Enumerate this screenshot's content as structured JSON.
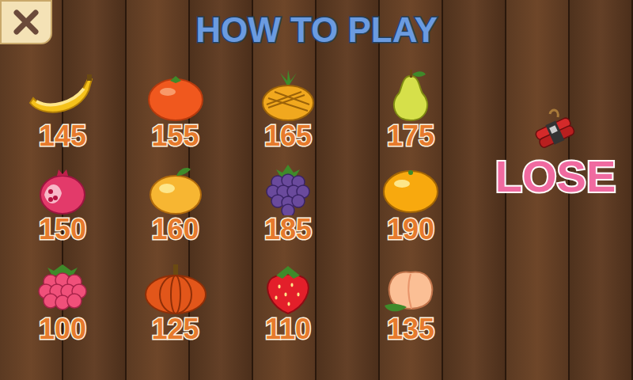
{
  "screen": {
    "title": "HOW TO PLAY"
  },
  "fruits": [
    {
      "kind": "banana",
      "score": "145"
    },
    {
      "kind": "tangerine",
      "score": "155"
    },
    {
      "kind": "pineapple",
      "score": "165"
    },
    {
      "kind": "pear",
      "score": "175"
    },
    {
      "kind": "pomegranate",
      "score": "150"
    },
    {
      "kind": "apricot",
      "score": "160"
    },
    {
      "kind": "blackberry",
      "score": "185"
    },
    {
      "kind": "orange",
      "score": "190"
    },
    {
      "kind": "raspberry",
      "score": "100"
    },
    {
      "kind": "pumpkin",
      "score": "125"
    },
    {
      "kind": "strawberry",
      "score": "110"
    },
    {
      "kind": "peach",
      "score": "135"
    }
  ],
  "hazard": {
    "label": "LOSE"
  }
}
